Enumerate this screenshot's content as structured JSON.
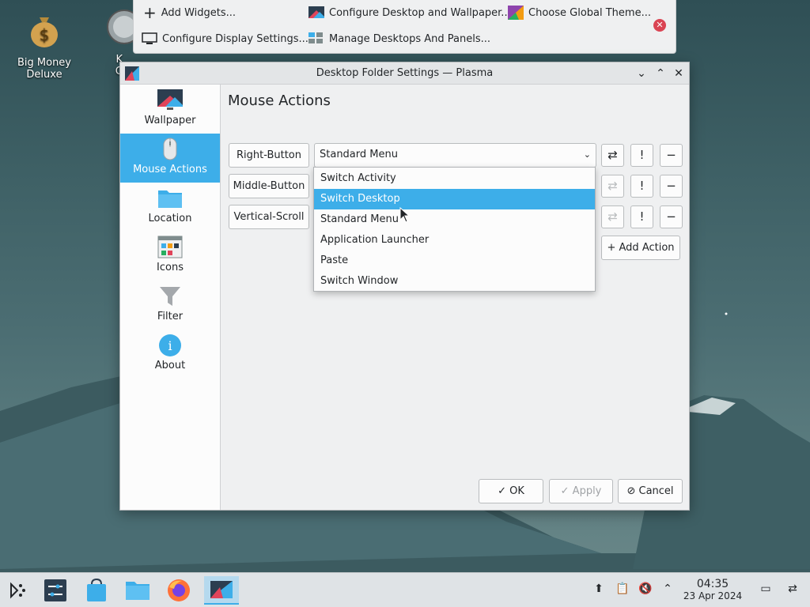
{
  "desktop": {
    "icons": [
      {
        "label_line1": "Big Money",
        "label_line2": "Deluxe"
      },
      {
        "label_line1": "K",
        "label_line2": "Opti"
      }
    ]
  },
  "toolbox": {
    "add_widgets": "Add Widgets...",
    "configure_desktop": "Configure Desktop and Wallpaper...",
    "choose_theme": "Choose Global Theme...",
    "configure_display": "Configure Display Settings...",
    "manage_desktops": "Manage Desktops And Panels..."
  },
  "dialog": {
    "title": "Desktop Folder Settings — Plasma",
    "sidebar": [
      {
        "label": "Wallpaper",
        "icon": "monitor-icon"
      },
      {
        "label": "Mouse Actions",
        "icon": "mouse-icon"
      },
      {
        "label": "Location",
        "icon": "folder-icon"
      },
      {
        "label": "Icons",
        "icon": "icons-grid-icon"
      },
      {
        "label": "Filter",
        "icon": "funnel-icon"
      },
      {
        "label": "About",
        "icon": "info-icon"
      }
    ],
    "page_title": "Mouse Actions",
    "triggers": [
      "Right-Button",
      "Middle-Button",
      "Vertical-Scroll"
    ],
    "selected_action": "Standard Menu",
    "dropdown_options": [
      "Switch Activity",
      "Switch Desktop",
      "Standard Menu",
      "Application Launcher",
      "Paste",
      "Switch Window"
    ],
    "highlighted_option": "Switch Desktop",
    "add_action": "Add Action",
    "ok": "OK",
    "apply": "Apply",
    "cancel": "Cancel"
  },
  "taskbar": {
    "time": "04:35",
    "date": "23 Apr 2024"
  },
  "colors": {
    "accent": "#3daee9",
    "close_red": "#da4453"
  }
}
